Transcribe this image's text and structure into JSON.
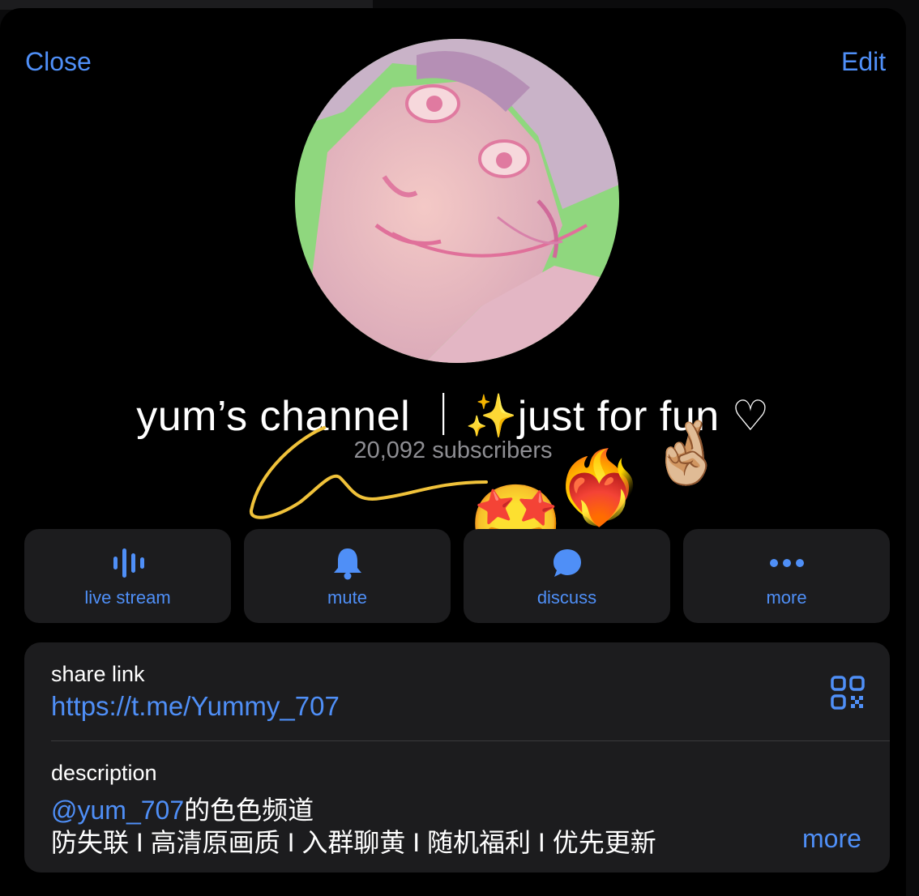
{
  "nav": {
    "close_label": "Close",
    "edit_label": "Edit"
  },
  "channel": {
    "title": "yum’s channel ｜✨just for fun ♡",
    "subscribers": "20,092 subscribers"
  },
  "actions": [
    {
      "label": "live stream",
      "icon": "waveform-icon"
    },
    {
      "label": "mute",
      "icon": "bell-icon"
    },
    {
      "label": "discuss",
      "icon": "chat-bubble-icon"
    },
    {
      "label": "more",
      "icon": "ellipsis-icon"
    }
  ],
  "info": {
    "share_label": "share link",
    "share_link": "https://t.me/Yummy_707",
    "description_label": "description",
    "description_mention": "@yum_707",
    "description_line1_rest": "的色色频道",
    "description_line2": "防失联 I 高清原画质 I 入群聊黄 I 随机福利 I 优先更新",
    "more_label": "more"
  },
  "stickers": [
    "🤩",
    "❤️‍🔥",
    "🤞🏼"
  ],
  "colors": {
    "accent": "#4f8ff7",
    "card": "#1c1c1e",
    "background": "#000000",
    "secondary_text": "#8e8e93",
    "doodle": "#f0c23a"
  }
}
